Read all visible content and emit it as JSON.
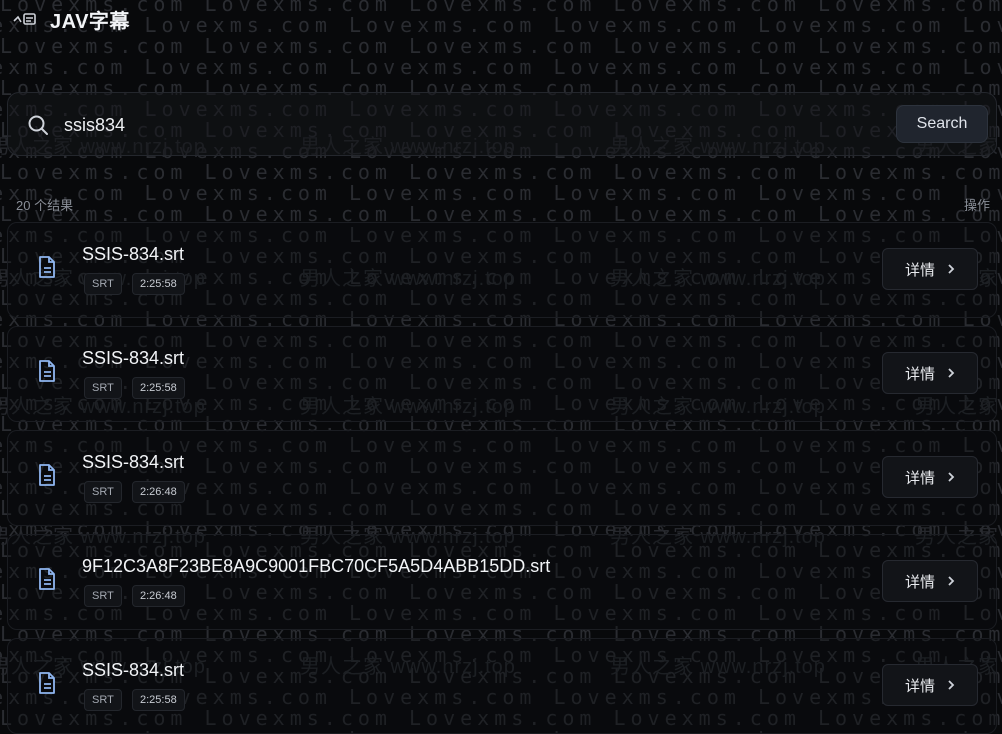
{
  "app": {
    "title": "JAV字幕"
  },
  "search": {
    "value": "ssis834",
    "button_label": "Search"
  },
  "results": {
    "count_label": "20 个结果",
    "actions_label": "操作",
    "items": [
      {
        "name": "SSIS-834.srt",
        "type": "SRT",
        "duration": "2:25:58",
        "detail_label": "详情"
      },
      {
        "name": "SSIS-834.srt",
        "type": "SRT",
        "duration": "2:25:58",
        "detail_label": "详情"
      },
      {
        "name": "SSIS-834.srt",
        "type": "SRT",
        "duration": "2:26:48",
        "detail_label": "详情"
      },
      {
        "name": "9F12C3A8F23BE8A9C9001FBC70CF5A5D4ABB15DD.srt",
        "type": "SRT",
        "duration": "2:26:48",
        "detail_label": "详情"
      },
      {
        "name": "SSIS-834.srt",
        "type": "SRT",
        "duration": "2:25:58",
        "detail_label": "详情"
      }
    ]
  },
  "watermark": {
    "text_a": "Lovexms.com",
    "text_b": "男人之家 www.nrzj.top"
  }
}
